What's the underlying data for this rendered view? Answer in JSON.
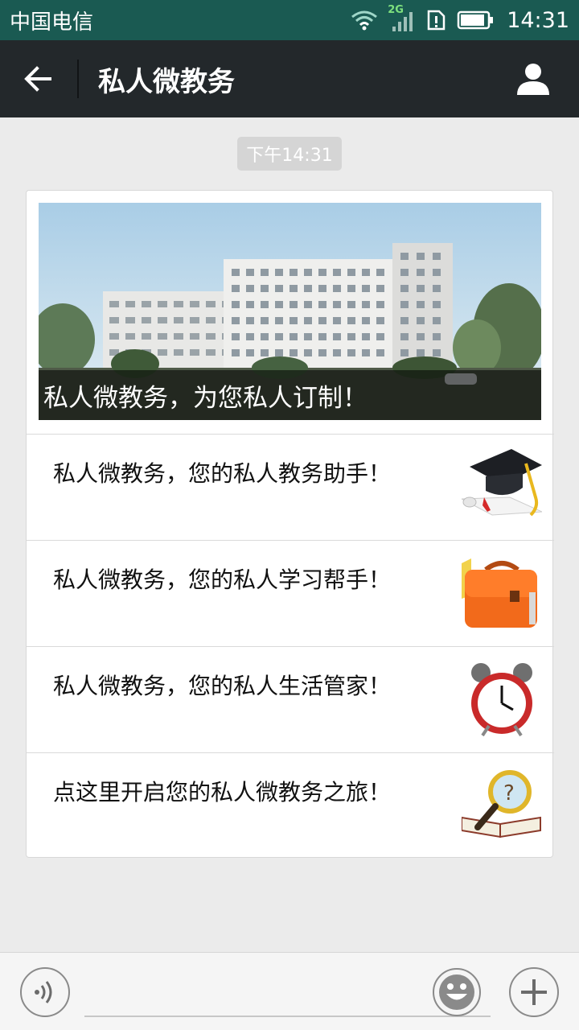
{
  "status_bar": {
    "carrier": "中国电信",
    "network": "2G",
    "time": "14:31",
    "icons": [
      "wifi-icon",
      "signal-icon",
      "sim-alert-icon",
      "battery-icon"
    ]
  },
  "nav": {
    "title": "私人微教务",
    "back_icon": "arrow-left-icon",
    "profile_icon": "person-icon"
  },
  "chat": {
    "timestamp": "下午14:31"
  },
  "article": {
    "cover_caption": "私人微教务，为您私人订制！",
    "cover_image": "campus-building-image",
    "items": [
      {
        "text": "私人微教务，您的私人教务助手！",
        "thumb": "graduation-cap-diploma-icon"
      },
      {
        "text": "私人微教务，您的私人学习帮手！",
        "thumb": "orange-schoolbag-icon"
      },
      {
        "text": "私人微教务，您的私人生活管家！",
        "thumb": "red-alarm-clock-icon"
      },
      {
        "text": "点这里开启您的私人微教务之旅！",
        "thumb": "magnifier-book-icon"
      }
    ]
  },
  "input_bar": {
    "voice_icon": "voice-icon",
    "input_value": "",
    "emoji_icon": "smiley-icon",
    "plus_icon": "plus-icon"
  },
  "colors": {
    "status_bar": "#1a5a52",
    "nav_bar": "#23282b",
    "background": "#ebebeb"
  }
}
